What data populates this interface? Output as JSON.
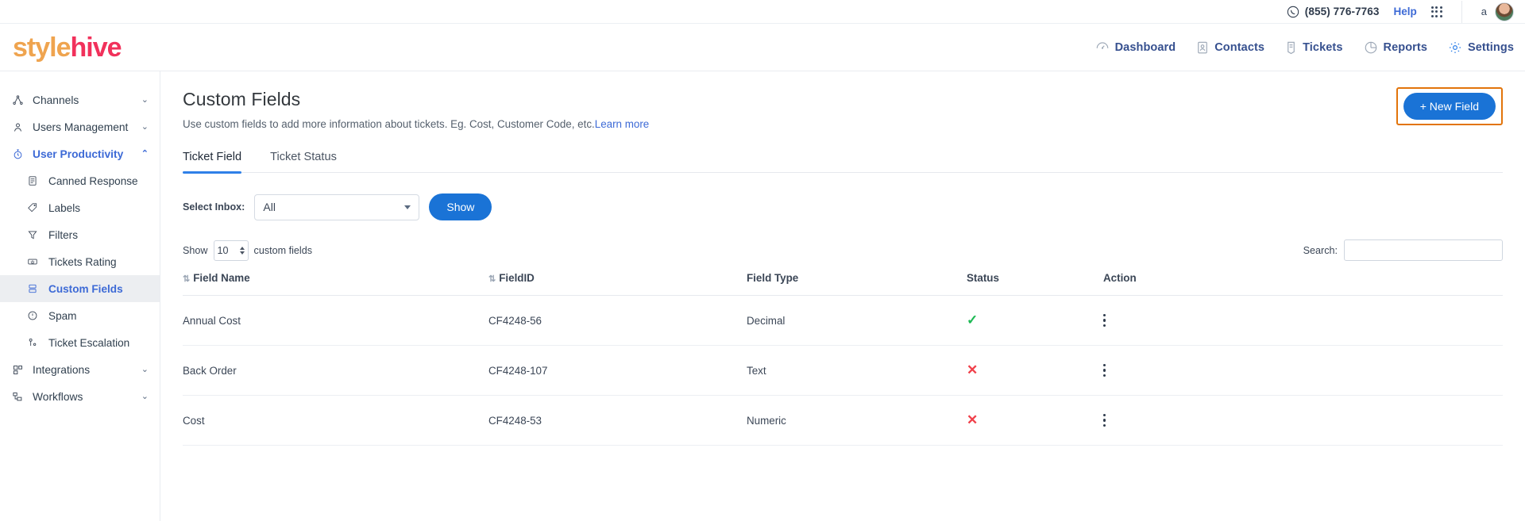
{
  "topbar": {
    "phone_icon": "phone-circle-icon",
    "phone": "(855) 776-7763",
    "help": "Help",
    "apps_icon": "apps-grid-icon",
    "account_name": "a",
    "avatar_icon": "user-avatar"
  },
  "brand": {
    "part1": "style",
    "part2": "hive"
  },
  "mainnav": [
    {
      "label": "Dashboard",
      "icon": "speedometer-icon"
    },
    {
      "label": "Contacts",
      "icon": "contact-card-icon"
    },
    {
      "label": "Tickets",
      "icon": "ticket-icon"
    },
    {
      "label": "Reports",
      "icon": "pie-chart-icon"
    },
    {
      "label": "Settings",
      "icon": "gear-icon"
    }
  ],
  "sidebar": {
    "items": [
      {
        "label": "Channels",
        "icon": "share-nodes-icon",
        "caret": "⌄",
        "type": "group"
      },
      {
        "label": "Users Management",
        "icon": "user-gear-icon",
        "caret": "⌄",
        "type": "group"
      },
      {
        "label": "User Productivity",
        "icon": "stopwatch-icon",
        "caret": "⌃",
        "type": "group",
        "state": "expanded"
      },
      {
        "label": "Canned Response",
        "icon": "document-lines-icon",
        "type": "sub"
      },
      {
        "label": "Labels",
        "icon": "tag-icon",
        "type": "sub"
      },
      {
        "label": "Filters",
        "icon": "funnel-icon",
        "type": "sub"
      },
      {
        "label": "Tickets Rating",
        "icon": "star-box-icon",
        "type": "sub"
      },
      {
        "label": "Custom Fields",
        "icon": "custom-fields-icon",
        "type": "sub",
        "state": "current"
      },
      {
        "label": "Spam",
        "icon": "alert-circle-icon",
        "type": "sub"
      },
      {
        "label": "Ticket Escalation",
        "icon": "escalation-icon",
        "type": "sub"
      },
      {
        "label": "Integrations",
        "icon": "blocks-icon",
        "caret": "⌄",
        "type": "group"
      },
      {
        "label": "Workflows",
        "icon": "workflow-icon",
        "caret": "⌄",
        "type": "group"
      }
    ]
  },
  "page": {
    "title": "Custom Fields",
    "subtitle": "Use custom fields to add more information about tickets. Eg. Cost, Customer Code, etc.",
    "learn_more": "Learn more",
    "new_field_button": "+ New Field",
    "highlight_color": "#e2740b"
  },
  "tabs": [
    {
      "label": "Ticket Field",
      "active": true
    },
    {
      "label": "Ticket Status",
      "active": false
    }
  ],
  "filter": {
    "select_label": "Select Inbox:",
    "select_value": "All",
    "show_button": "Show"
  },
  "table_tools": {
    "show_prefix": "Show",
    "page_size": "10",
    "show_suffix": "custom fields",
    "search_label": "Search:",
    "search_value": "",
    "search_placeholder": ""
  },
  "table": {
    "columns": [
      "Field Name",
      "FieldID",
      "Field Type",
      "Status",
      "Action"
    ],
    "sortable": [
      true,
      true,
      false,
      false,
      false
    ],
    "rows": [
      {
        "name": "Annual Cost",
        "id": "CF4248-56",
        "type": "Decimal",
        "status": "enabled",
        "status_glyph": "✓",
        "action_icon": "kebab-menu-icon"
      },
      {
        "name": "Back Order",
        "id": "CF4248-107",
        "type": "Text",
        "status": "disabled",
        "status_glyph": "✕",
        "action_icon": "kebab-menu-icon"
      },
      {
        "name": "Cost",
        "id": "CF4248-53",
        "type": "Numeric",
        "status": "disabled",
        "status_glyph": "✕",
        "action_icon": "kebab-menu-icon"
      }
    ]
  },
  "colors": {
    "primary": "#1a73d6",
    "nav_text": "#36508f",
    "ok": "#1db954",
    "bad": "#f0404a"
  }
}
